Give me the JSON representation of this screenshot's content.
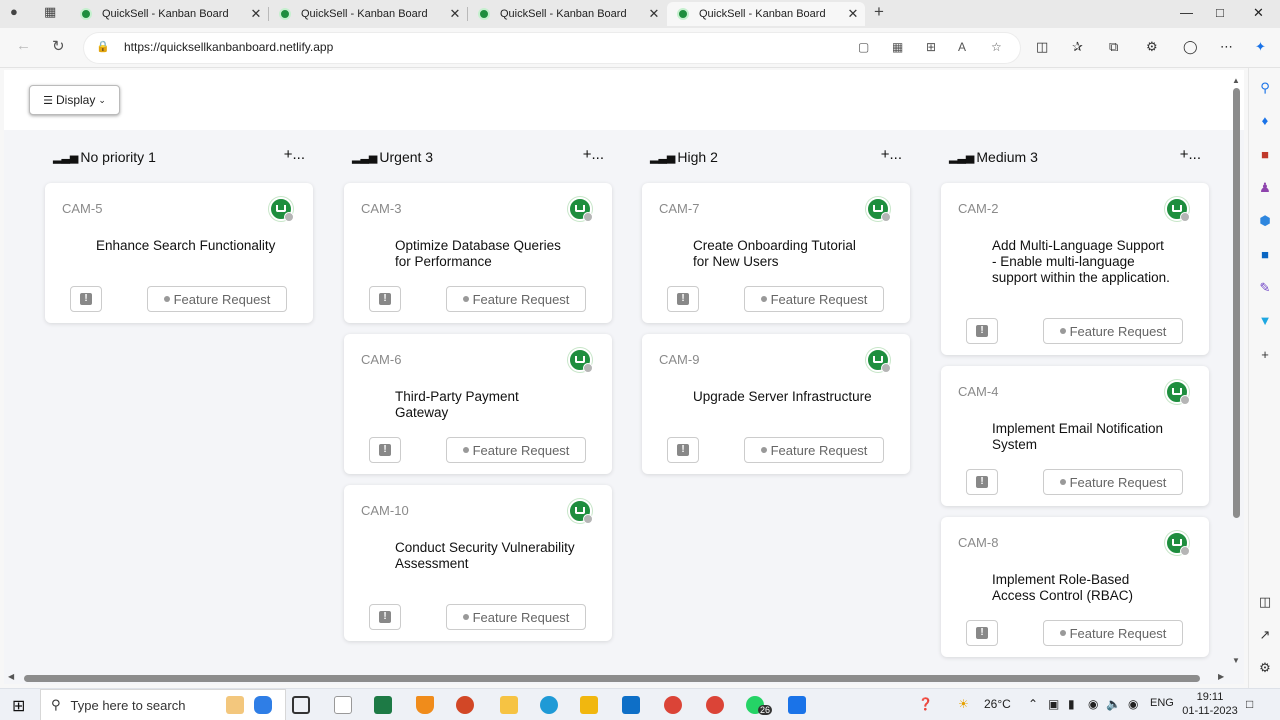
{
  "browser": {
    "tabs": [
      {
        "title": "QuickSell - Kanban Board",
        "active": false
      },
      {
        "title": "QuickSell - Kanban Board",
        "active": false
      },
      {
        "title": "QuickSell - Kanban Board",
        "active": false
      },
      {
        "title": "QuickSell - Kanban Board",
        "active": true
      }
    ],
    "new_tab": "+",
    "url": "https://quicksellkanbanboard.netlify.app"
  },
  "toolbar": {
    "display_label": "Display"
  },
  "columns": [
    {
      "title": "No priority 1",
      "add": "+",
      "more": "...",
      "cards": [
        {
          "id": "CAM-5",
          "title": "Enhance Search Functionality",
          "tag": "Feature Request"
        }
      ]
    },
    {
      "title": "Urgent 3",
      "add": "+",
      "more": "...",
      "cards": [
        {
          "id": "CAM-3",
          "title": "Optimize Database Queries for Performance",
          "tag": "Feature Request"
        },
        {
          "id": "CAM-6",
          "title": "Third-Party Payment Gateway",
          "tag": "Feature Request"
        },
        {
          "id": "CAM-10",
          "title": "Conduct Security Vulnerability Assessment",
          "tag": "Feature Request"
        }
      ]
    },
    {
      "title": "High 2",
      "add": "+",
      "more": "...",
      "cards": [
        {
          "id": "CAM-7",
          "title": "Create Onboarding Tutorial for New Users",
          "tag": "Feature Request"
        },
        {
          "id": "CAM-9",
          "title": "Upgrade Server Infrastructure",
          "tag": "Feature Request"
        }
      ]
    },
    {
      "title": "Medium 3",
      "add": "+",
      "more": "...",
      "cards": [
        {
          "id": "CAM-2",
          "title": "Add Multi-Language Support - Enable multi-language support within the application.",
          "tag": "Feature Request"
        },
        {
          "id": "CAM-4",
          "title": "Implement Email Notification System",
          "tag": "Feature Request"
        },
        {
          "id": "CAM-8",
          "title": "Implement Role-Based Access Control (RBAC)",
          "tag": "Feature Request"
        }
      ]
    }
  ],
  "taskbar": {
    "search_placeholder": "Type here to search",
    "badge_count": "26",
    "weather": "26°C",
    "language": "ENG",
    "time": "19:11",
    "date": "01-11-2023"
  },
  "colors": {
    "avatar": "#1e8e3e",
    "board_bg": "#f4f5f8"
  }
}
